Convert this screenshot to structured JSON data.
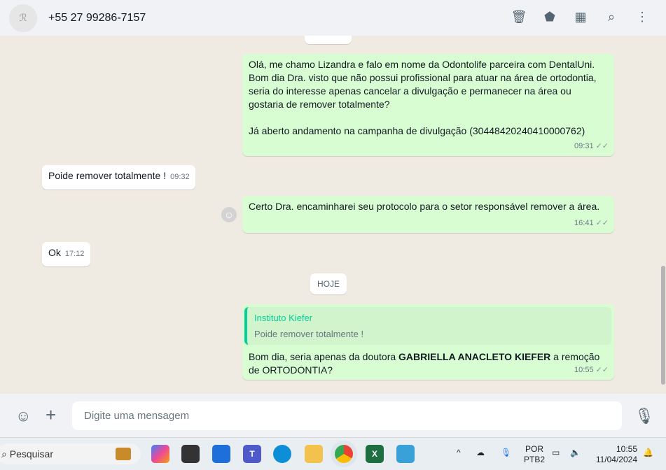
{
  "header": {
    "avatar_text": "Instituto Kiefer",
    "contact": "+55 27 99286-7157",
    "icons": [
      "delete-icon",
      "label-icon",
      "shop-icon",
      "search-icon",
      "menu-icon"
    ]
  },
  "messages": [
    {
      "dir": "out",
      "text": "Olá, me chamo Lizandra e falo em nome da Odontolife parceira com DentalUni. Bom dia Dra. visto que não possui profissional para atuar na área de ortodontia, seria do interesse apenas cancelar a divulgação e permanecer na área ou gostaria de remover totalmente?",
      "text2": "Já aberto andamento na campanha de divulgação (30448420240410000762)",
      "time": "09:31"
    },
    {
      "dir": "in",
      "text": "Poide remover totalmente !",
      "time": "09:32"
    },
    {
      "dir": "out",
      "text": "Certo Dra. encaminharei seu protocolo para o setor responsável remover a área.",
      "time": "16:41"
    },
    {
      "dir": "in",
      "text": "Ok",
      "time": "17:12"
    },
    {
      "dir": "out",
      "quote_name": "Instituto Kiefer",
      "quote_text": "Poide remover totalmente !",
      "text_a": "Bom dia, seria apenas da doutora ",
      "text_bold": "GABRIELLA ANACLETO KIEFER",
      "text_b": " a remoção de ORTODONTIA?",
      "time": "10:55"
    }
  ],
  "date_chip": "HOJE",
  "footer": {
    "placeholder": "Digite uma mensagem"
  },
  "taskbar": {
    "search": "Pesquisar",
    "lang1": "POR",
    "lang2": "PTB2",
    "time": "10:55",
    "date": "11/04/2024"
  }
}
